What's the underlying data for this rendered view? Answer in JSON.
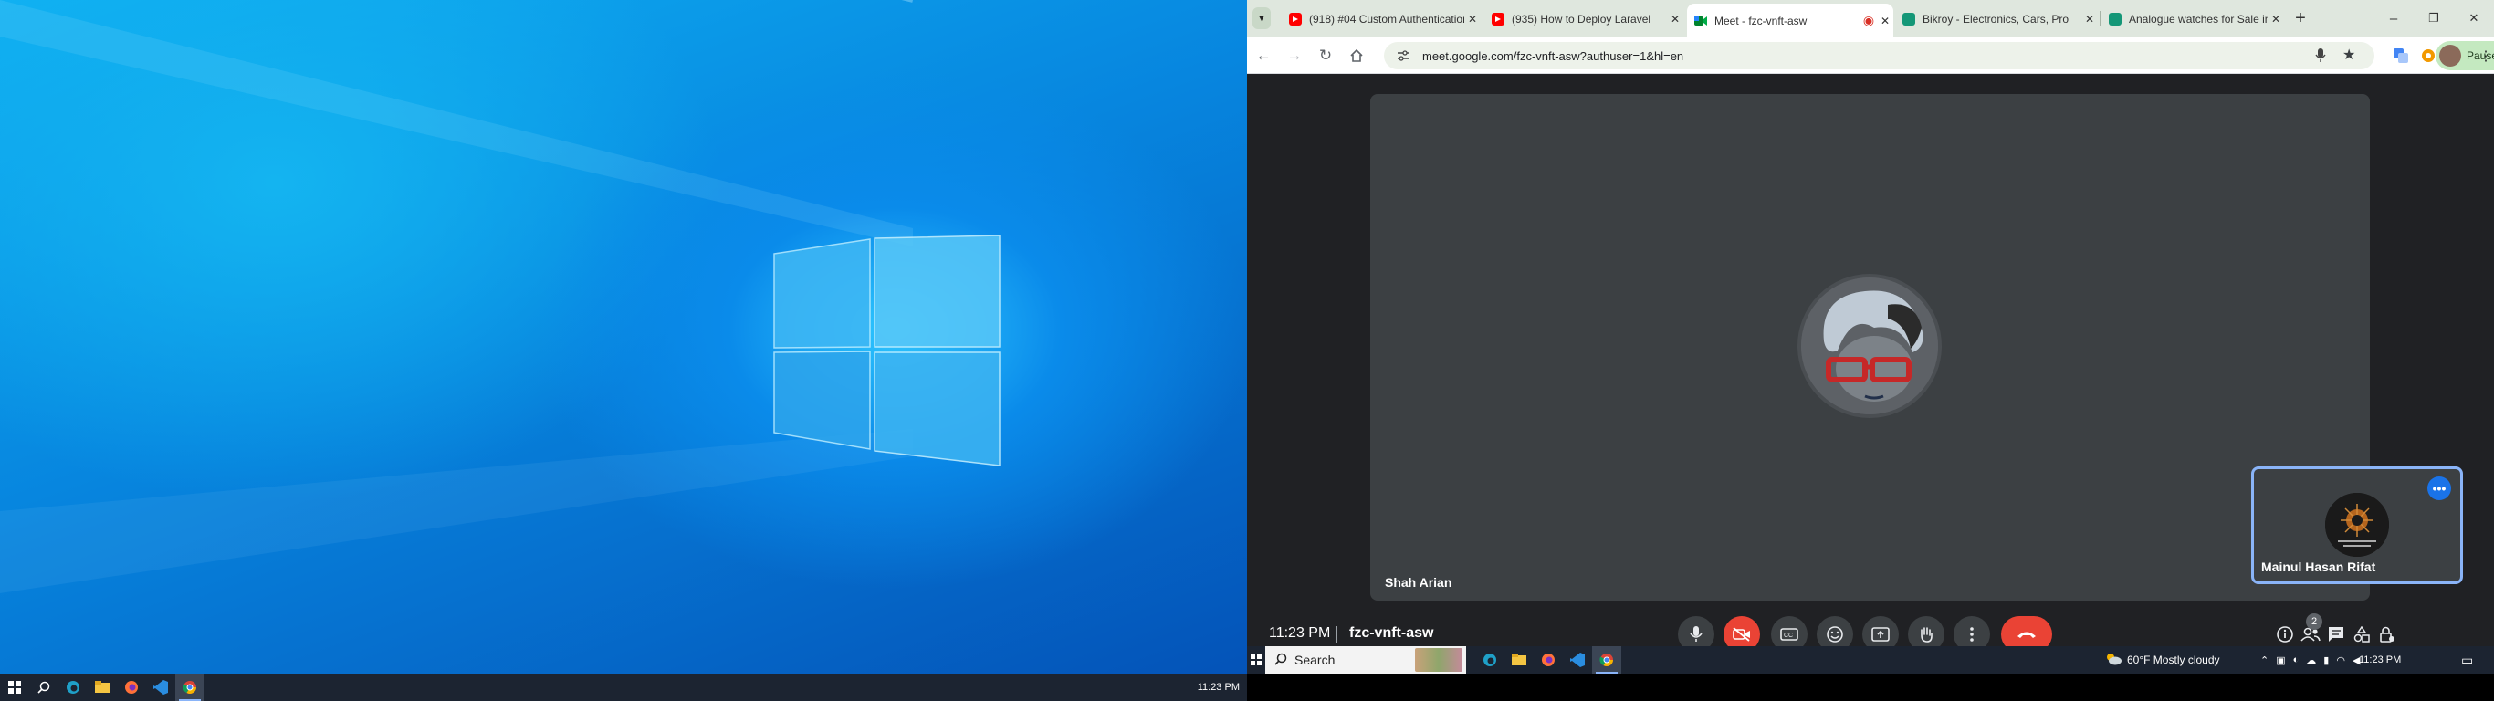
{
  "left_screen": {
    "taskbar": {
      "clock": "11:23 PM",
      "icons": [
        "windows-icon",
        "search-icon",
        "edge-icon",
        "file-explorer-icon",
        "firefox-icon",
        "vscode-icon",
        "chrome-icon"
      ]
    }
  },
  "browser": {
    "tabs": [
      {
        "title": "(918) #04 Custom Authentication",
        "favicon": "youtube-icon"
      },
      {
        "title": "(935) How to Deploy Laravel",
        "favicon": "youtube-icon"
      },
      {
        "title": "Meet - fzc-vnft-asw",
        "favicon": "meet-icon",
        "active": true
      },
      {
        "title": "Bikroy - Electronics, Cars, Pro",
        "favicon": "bikroy-icon"
      },
      {
        "title": "Analogue watches for Sale in",
        "favicon": "bikroy-icon"
      }
    ],
    "new_tab": "+",
    "window_controls": {
      "minimize": "–",
      "restore": "❐",
      "close": "✕"
    },
    "url": "meet.google.com/fzc-vnft-asw?authuser=1&hl=en",
    "profile_status": "Paused"
  },
  "meet": {
    "main_participant": "Shah Arian",
    "self_participant": "Mainul Hasan Rifat",
    "time": "11:23 PM",
    "meeting_code": "fzc-vnft-asw",
    "people_count": "2"
  },
  "right_taskbar": {
    "search_label": "Search",
    "weather": "60°F  Mostly cloudy",
    "clock": "11:23 PM"
  },
  "colors": {
    "accent": "#1a73e8",
    "end_call": "#ea4335",
    "meet_bg": "#202124"
  }
}
